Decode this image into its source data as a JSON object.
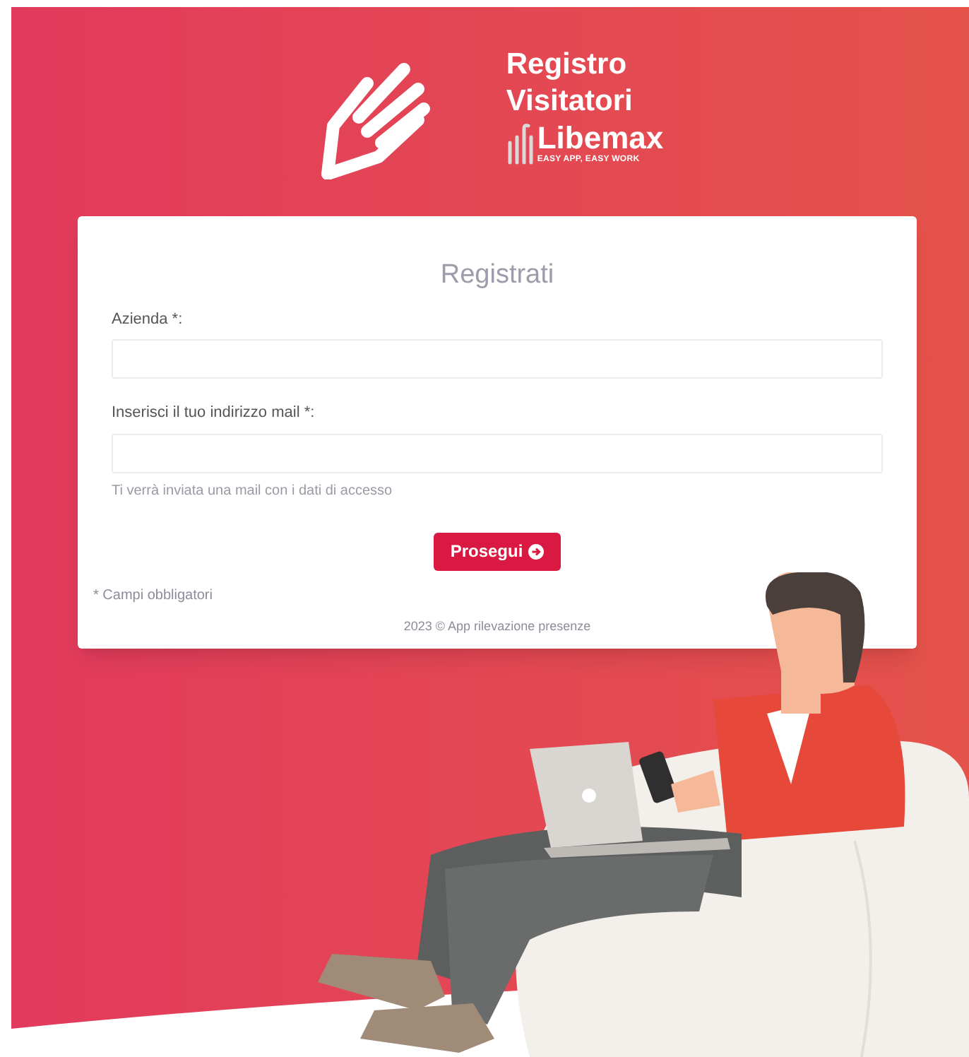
{
  "header": {
    "title_lines": [
      "Registro",
      "Visitatori"
    ],
    "brand": "Libemax",
    "tagline": "EASY APP, EASY WORK"
  },
  "form": {
    "title": "Registrati",
    "fields": [
      {
        "label": "Azienda *:"
      },
      {
        "label": "Inserisci il tuo indirizzo mail *:",
        "hint": "Ti verrà inviata una mail con i dati di accesso"
      }
    ],
    "button": "Prosegui",
    "required_note": "* Campi obbligatori",
    "footer": "2023 © App rilevazione presenze"
  }
}
